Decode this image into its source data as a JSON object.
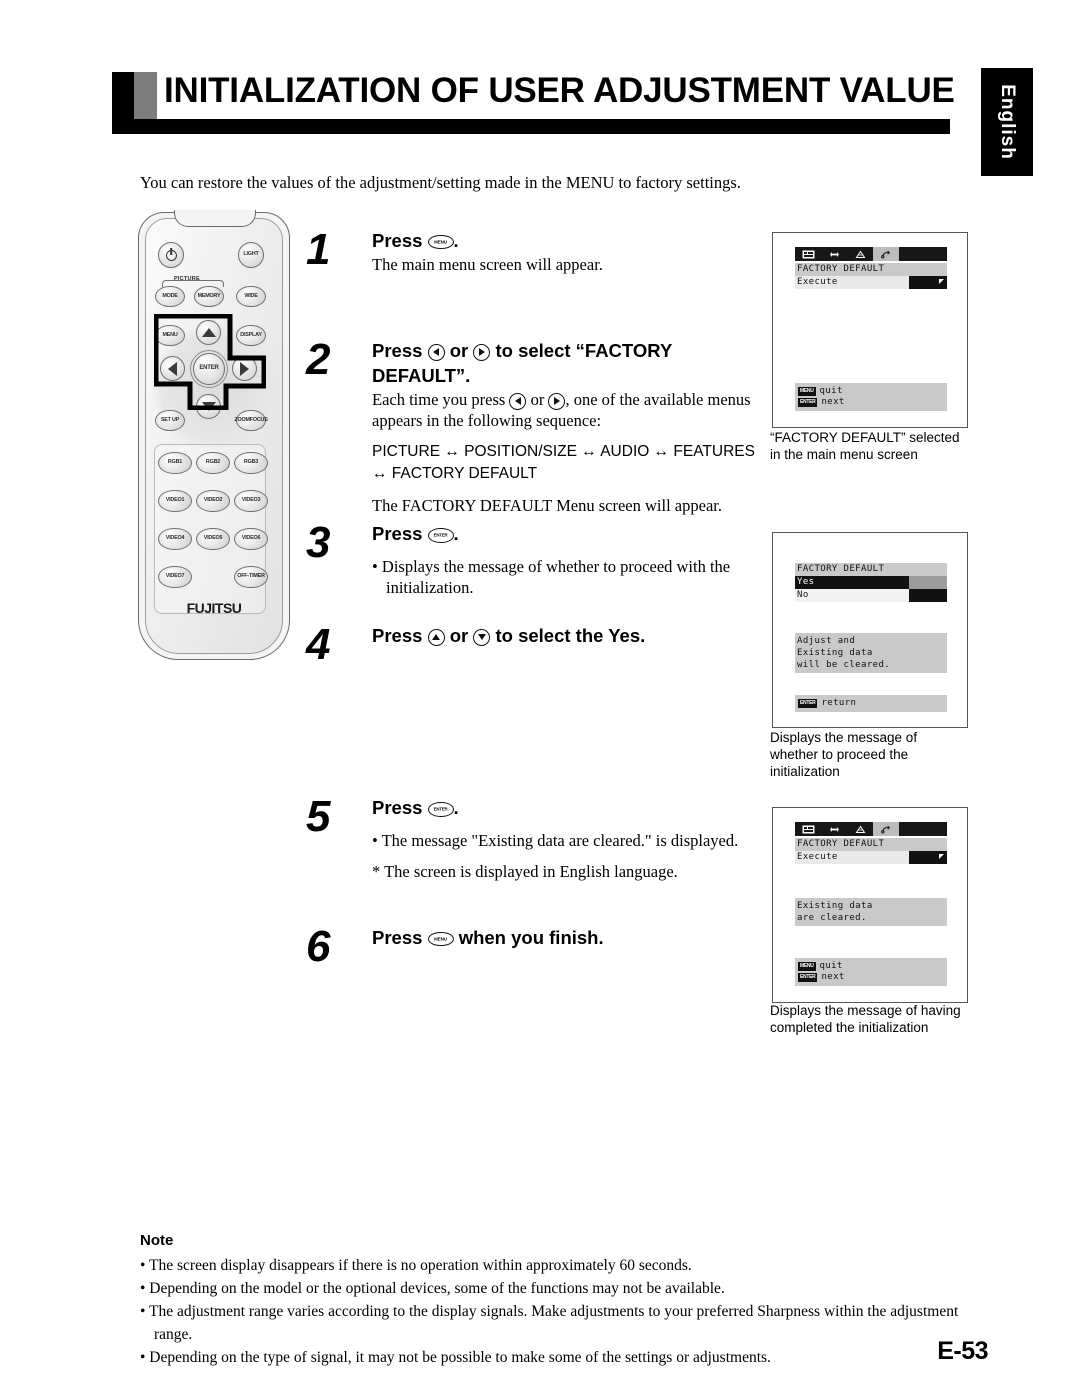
{
  "header": {
    "title": "INITIALIZATION OF USER ADJUSTMENT VALUE",
    "language_tab": "English"
  },
  "intro": "You can restore the values of the adjustment/setting made in the MENU to factory settings.",
  "remote": {
    "buttons": [
      "POWER",
      "LIGHT",
      "PICTURE",
      "MODE",
      "MEMORY",
      "WIDE",
      "MENU",
      "DISPLAY",
      "ENTER",
      "SET UP",
      "ZOOM FOCUS",
      "RGB1",
      "RGB2",
      "RGB3",
      "VIDEO1",
      "VIDEO2",
      "VIDEO3",
      "VIDEO4",
      "VIDEO5",
      "VIDEO6",
      "VIDEO7",
      "OFF TIMER"
    ],
    "labels": {
      "light": "LIGHT",
      "picture": "PICTURE",
      "mode": "MODE",
      "memory": "MEMORY",
      "wide": "WIDE",
      "menu": "MENU",
      "display": "DISPLAY",
      "enter": "ENTER",
      "setup": "SET UP",
      "zoom": "ZOOM",
      "focus": "FOCUS",
      "rgb1": "RGB1",
      "rgb2": "RGB2",
      "rgb3": "RGB3",
      "video1": "VIDEO1",
      "video2": "VIDEO2",
      "video3": "VIDEO3",
      "video4": "VIDEO4",
      "video5": "VIDEO5",
      "video6": "VIDEO6",
      "video7": "VIDEO7",
      "off": "OFF-",
      "timer": "TIMER",
      "brand": "FUJITSU"
    }
  },
  "steps": [
    {
      "num": "1",
      "head_pre": "Press",
      "head_post": ".",
      "key": "menu",
      "sub": "The main menu screen will appear."
    },
    {
      "num": "2",
      "head_pre": "Press",
      "head_mid": "or",
      "head_post": "to select “FACTORY DEFAULT”.",
      "sub1_a": "Each time you press",
      "sub1_b": "or",
      "sub1_c": ", one of the available",
      "sub1_d": "menus appears in the following sequence:",
      "sequence": "PICTURE ↔ POSITION/SIZE ↔ AUDIO ↔ FEATURES ↔ FACTORY DEFAULT",
      "sub2": "The FACTORY DEFAULT Menu screen will appear."
    },
    {
      "num": "3",
      "head_pre": "Press",
      "head_post": ".",
      "key": "enter",
      "bullet": "• Displays the message of whether to proceed with the initialization."
    },
    {
      "num": "4",
      "head_pre": "Press",
      "head_mid": "or",
      "head_post": "to select the Yes."
    },
    {
      "num": "5",
      "head_pre": "Press",
      "head_post": ".",
      "key": "enter",
      "bullet": "• The message \"Existing data are cleared.\" is displayed.",
      "note": "* The screen is displayed in English language."
    },
    {
      "num": "6",
      "head_pre": "Press",
      "head_post": "when you finish.",
      "key": "menu"
    }
  ],
  "osd_screens": [
    {
      "id": "osd-1",
      "tabs": [
        "picture-icon",
        "position-size-icon",
        "audio-icon",
        "features-icon"
      ],
      "active_tab_index": 3,
      "title": "FACTORY DEFAULT",
      "row_label": "Execute",
      "footer": [
        {
          "badge": "MENU",
          "label": "quit"
        },
        {
          "badge": "ENTER",
          "label": "next"
        }
      ],
      "caption": "“FACTORY DEFAULT” selected\nin the main menu screen"
    },
    {
      "id": "osd-2",
      "title": "FACTORY DEFAULT",
      "option_yes": "Yes",
      "option_no": "No",
      "selected_option": "Yes",
      "message": "Adjust and\nExisting data\nwill be cleared.",
      "footer": [
        {
          "badge": "ENTER",
          "label": "return"
        }
      ],
      "caption": "Displays the message of\nwhether to proceed the\ninitialization"
    },
    {
      "id": "osd-3",
      "tabs": [
        "picture-icon",
        "position-size-icon",
        "audio-icon",
        "features-icon"
      ],
      "active_tab_index": 3,
      "title": "FACTORY DEFAULT",
      "row_label": "Execute",
      "message": "Existing data\nare cleared.",
      "footer": [
        {
          "badge": "MENU",
          "label": "quit"
        },
        {
          "badge": "ENTER",
          "label": "next"
        }
      ],
      "caption": "Displays the message of having\ncompleted the initialization"
    }
  ],
  "note": {
    "title": "Note",
    "items": [
      "• The screen display disappears if there is no operation within approximately 60 seconds.",
      "• Depending on the model or the optional devices, some of the functions may not be available.",
      "• The adjustment range varies according to the display signals. Make adjustments to your preferred Sharpness within the adjustment range.",
      "• Depending on the type of signal, it may not be possible to make some of the settings or adjustments."
    ]
  },
  "page_number": "E-53",
  "colors": {
    "header_black": "#000000",
    "header_gray": "#7d7d7d",
    "osd_panel_gray": "#c9c9c9",
    "osd_dark": "#111111"
  }
}
